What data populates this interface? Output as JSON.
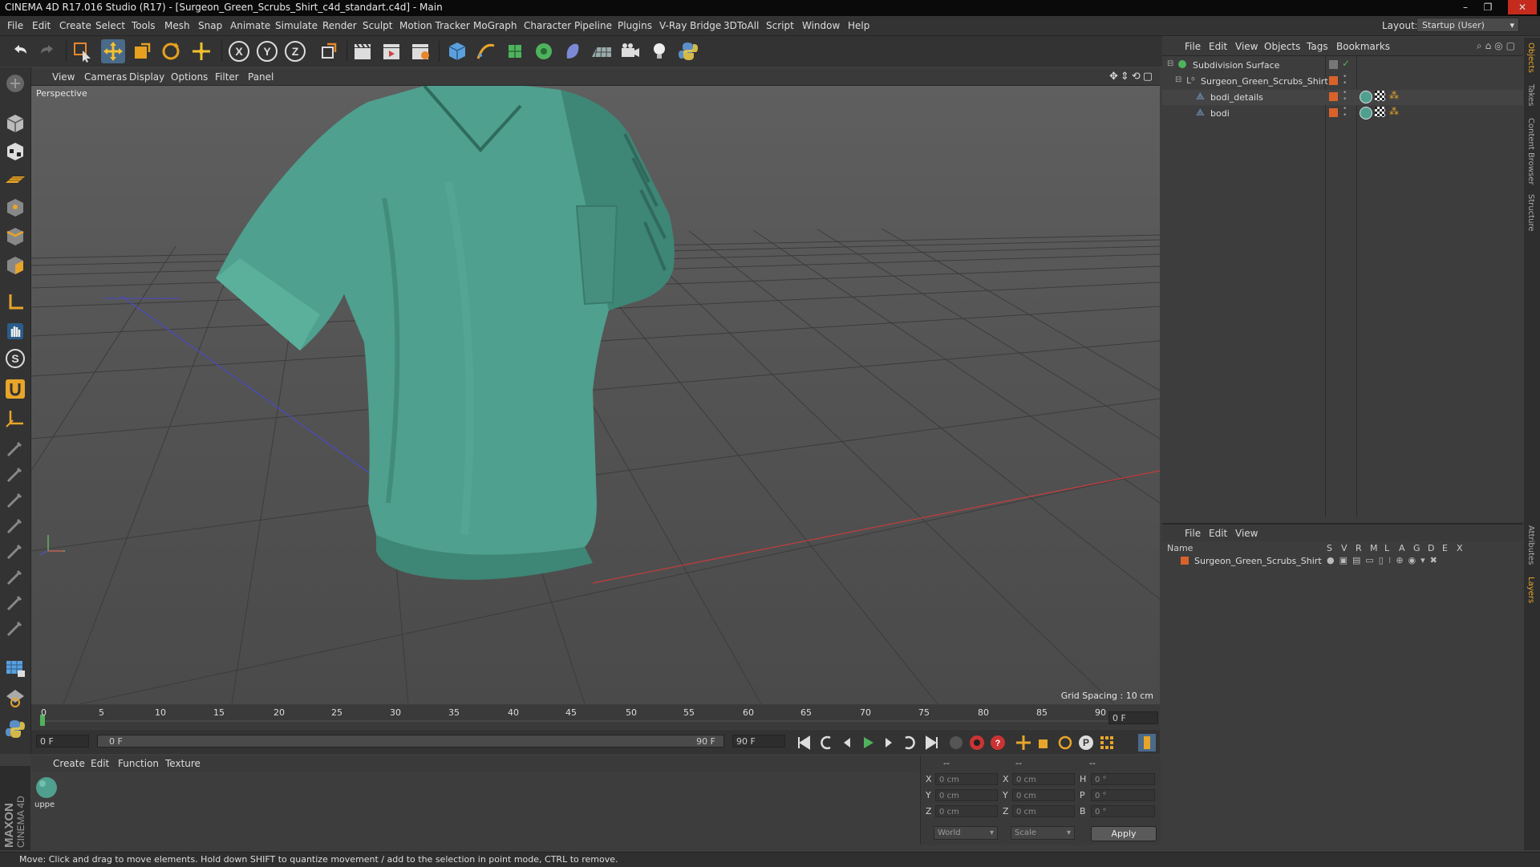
{
  "window": {
    "title": "CINEMA 4D R17.016 Studio (R17) - [Surgeon_Green_Scrubs_Shirt_c4d_standart.c4d] - Main",
    "minimize": "–",
    "restore": "❐",
    "close": "✕"
  },
  "menubar": {
    "items": [
      "File",
      "Edit",
      "Create",
      "Select",
      "Tools",
      "Mesh",
      "Snap",
      "Animate",
      "Simulate",
      "Render",
      "Sculpt",
      "Motion Tracker",
      "MoGraph",
      "Character",
      "Pipeline",
      "Plugins",
      "V-Ray Bridge",
      "3DToAll",
      "Script",
      "Window",
      "Help"
    ],
    "layout_label": "Layout:",
    "layout_value": "Startup (User)"
  },
  "toolbar": {
    "x_label": "X",
    "y_label": "Y",
    "z_label": "Z"
  },
  "viewport": {
    "menu": [
      "View",
      "Cameras",
      "Display",
      "Options",
      "Filter",
      "Panel"
    ],
    "label": "Perspective",
    "grid_spacing": "Grid Spacing : 10 cm"
  },
  "timeline": {
    "ticks": [
      "0",
      "5",
      "10",
      "15",
      "20",
      "25",
      "30",
      "35",
      "40",
      "45",
      "50",
      "55",
      "60",
      "65",
      "70",
      "75",
      "80",
      "85",
      "90"
    ],
    "current_frame": "0 F",
    "start_field": "0 F",
    "range_start": "0 F",
    "range_end": "90 F",
    "end_field": "90 F"
  },
  "materials": {
    "menu": [
      "Create",
      "Edit",
      "Function",
      "Texture"
    ],
    "items": [
      {
        "name": "uppe"
      }
    ]
  },
  "coordinates": {
    "header": [
      "--",
      "--",
      "--"
    ],
    "rows": [
      {
        "l1": "X",
        "v1": "0 cm",
        "l2": "X",
        "v2": "0 cm",
        "l3": "H",
        "v3": "0 °"
      },
      {
        "l1": "Y",
        "v1": "0 cm",
        "l2": "Y",
        "v2": "0 cm",
        "l3": "P",
        "v3": "0 °"
      },
      {
        "l1": "Z",
        "v1": "0 cm",
        "l2": "Z",
        "v2": "0 cm",
        "l3": "B",
        "v3": "0 °"
      }
    ],
    "space": "World",
    "mode": "Scale",
    "apply": "Apply"
  },
  "objects": {
    "menu": [
      "File",
      "Edit",
      "View",
      "Objects",
      "Tags",
      "Bookmarks"
    ],
    "tree": [
      {
        "name": "Subdivision Surface"
      },
      {
        "name": "Surgeon_Green_Scrubs_Shirt"
      },
      {
        "name": "bodi_details"
      },
      {
        "name": "bodi"
      }
    ]
  },
  "layers": {
    "menu": [
      "File",
      "Edit",
      "View"
    ],
    "columns_name": "Name",
    "columns_flags": [
      "S",
      "V",
      "R",
      "M",
      "L",
      "A",
      "G",
      "D",
      "E",
      "X"
    ],
    "rows": [
      {
        "name": "Surgeon_Green_Scrubs_Shirt"
      }
    ]
  },
  "side_tabs": [
    "Objects",
    "Takes",
    "Content Browser",
    "Structure",
    "Attributes",
    "Layers"
  ],
  "status": "Move: Click and drag to move elements. Hold down SHIFT to quantize movement / add to the selection in point mode, CTRL to remove.",
  "brand": {
    "maxon": "MAXON",
    "product": "CINEMA 4D"
  },
  "colors": {
    "accent": "#e8a52a",
    "layer_orange": "#d9622b",
    "shirt": "#4fa08e",
    "active_blue": "#3a7fc1"
  }
}
